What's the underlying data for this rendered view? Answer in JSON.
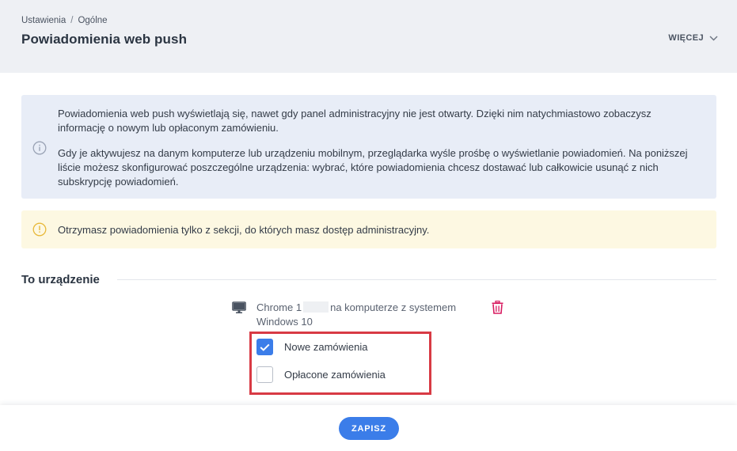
{
  "breadcrumb": {
    "parent": "Ustawienia",
    "separator": "/",
    "current": "Ogólne"
  },
  "header": {
    "title": "Powiadomienia web push",
    "more_label": "WIĘCEJ"
  },
  "info": {
    "icon": "info-icon",
    "paragraph1": "Powiadomienia web push wyświetlają się, nawet gdy panel administracyjny nie jest otwarty. Dzięki nim natychmiastowo zobaczysz informację o nowym lub opłaconym zamówieniu.",
    "paragraph2": "Gdy je aktywujesz na danym komputerze lub urządzeniu mobilnym, przeglądarka wyśle prośbę o wyświetlanie powiadomień. Na poniższej liście możesz skonfigurować poszczególne urządzenia: wybrać, które powiadomienia chcesz dostawać lub całkowicie usunąć z nich subskrypcję powiadomień."
  },
  "warning": {
    "icon": "warning-icon",
    "text": "Otrzymasz powiadomienia tylko z sekcji, do których masz dostęp administracyjny."
  },
  "section": {
    "title": "To urządzenie"
  },
  "device": {
    "icon": "monitor-icon",
    "browser": "Chrome",
    "version_fragment": "1",
    "description": "na komputerze z systemem Windows 10",
    "delete_icon": "trash-icon"
  },
  "options": [
    {
      "label": "Nowe zamówienia",
      "checked": true
    },
    {
      "label": "Opłacone zamówienia",
      "checked": false
    }
  ],
  "footer": {
    "save_label": "ZAPISZ"
  },
  "colors": {
    "accent": "#3b7de9",
    "danger": "#d81b60",
    "highlight_border": "#d83a44",
    "info_bg": "#e8edf7",
    "warning_bg": "#fdf8e2"
  }
}
